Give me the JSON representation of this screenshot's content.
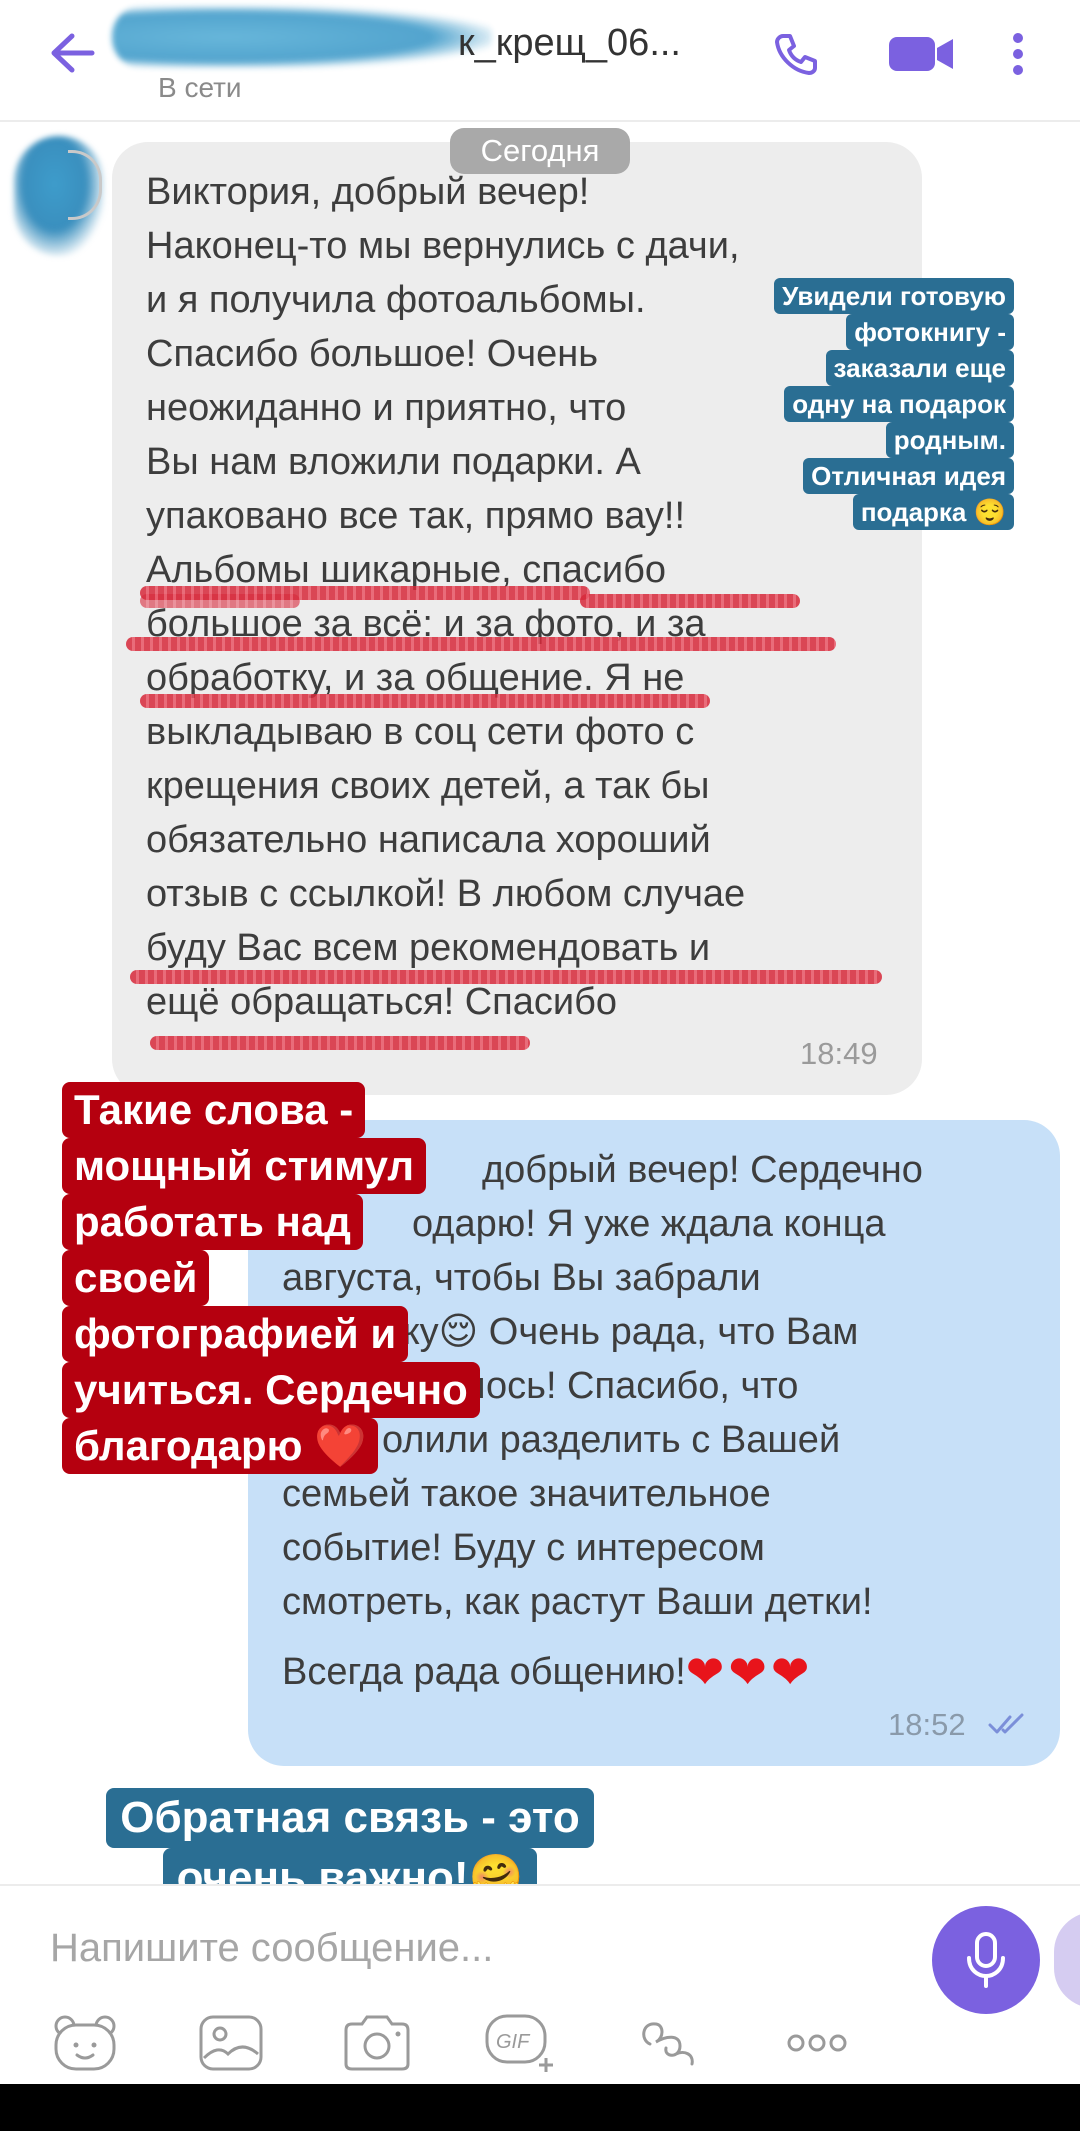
{
  "header": {
    "title": "к_крещ_06...",
    "status": "В сети",
    "accent_color": "#7b61e0",
    "icons": [
      "back-arrow-icon",
      "phone-icon",
      "video-camera-icon",
      "more-vertical-icon"
    ]
  },
  "chat": {
    "date_chip": "Сегодня",
    "incoming": {
      "lines": [
        "Виктория, добрый вечер!",
        "Наконец-то мы вернулись с дачи,",
        "и я получила фотоальбомы.",
        "Спасибо большое! Очень",
        "неожиданно и приятно, что",
        "Вы нам вложили подарки. А",
        "упаковано все так, прямо вау!!",
        "Альбомы шикарные, спасибо",
        "большое за всё: и за фото, и за",
        "обработку, и за общение. Я не",
        "выкладываю в соц сети фото с",
        "крещения своих детей, а так бы",
        "обязательно написала хороший",
        "отзыв с ссылкой! В любом случае",
        "буду Вас всем рекомендовать и",
        "ещё обращаться! Спасибо"
      ],
      "time": "18:49"
    },
    "outgoing": {
      "lines": [
        "добрый вечер! Сердечно",
        "одарю! Я уже ждала конца",
        "августа, чтобы Вы забрали",
        "пку😌 Очень рада, что Вам",
        "вилось! Спасибо,  что",
        "олили разделить с Вашей",
        "семьей такое значительное",
        "событие! Буду с интересом",
        "смотреть, как растут Ваши детки!"
      ],
      "closing": "Всегда рада общению!",
      "hearts": "❤❤❤",
      "time": "18:52",
      "status_icon": "double-check-icon"
    }
  },
  "stickers": {
    "top_right": [
      "Увидели готовую",
      "фотокнигу -",
      "заказали еще",
      "одну на подарок",
      "родным.",
      "Отличная идея",
      "подарка 😌"
    ],
    "left_red": [
      "Такие слова -",
      "мощный стимул",
      "работать над",
      "своей",
      "фотографией и",
      "учиться. Сердечно",
      "благодарю ❤️"
    ],
    "bottom": [
      "Обратная связь - это",
      "очень важно!🤗"
    ]
  },
  "composer": {
    "placeholder": "Напишите сообщение...",
    "tools": [
      "sticker-bear-icon",
      "gallery-icon",
      "camera-icon",
      "gif-icon",
      "doodle-icon",
      "more-horizontal-icon"
    ],
    "mic_icon": "microphone-icon"
  },
  "colors": {
    "incoming_bubble": "#ededed",
    "outgoing_bubble": "#c7e0f8",
    "sticker_blue": "#2a6e93",
    "sticker_red": "#b5000f",
    "underline_red": "#d7293a"
  }
}
